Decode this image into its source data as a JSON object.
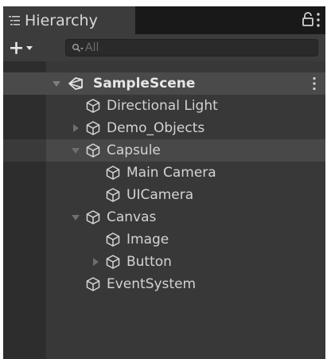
{
  "panel": {
    "tab_label": "Hierarchy",
    "search_placeholder": "All"
  },
  "tree": {
    "scene_name": "SampleScene",
    "rows": [
      {
        "label": "Directional Light"
      },
      {
        "label": "Demo_Objects"
      },
      {
        "label": "Capsule"
      },
      {
        "label": "Main Camera"
      },
      {
        "label": "UICamera"
      },
      {
        "label": "Canvas"
      },
      {
        "label": "Image"
      },
      {
        "label": "Button"
      },
      {
        "label": "EventSystem"
      }
    ]
  },
  "colors": {
    "panel_bg": "#383838",
    "header_bg": "#3c3c3c",
    "text": "#d3d3d3"
  }
}
